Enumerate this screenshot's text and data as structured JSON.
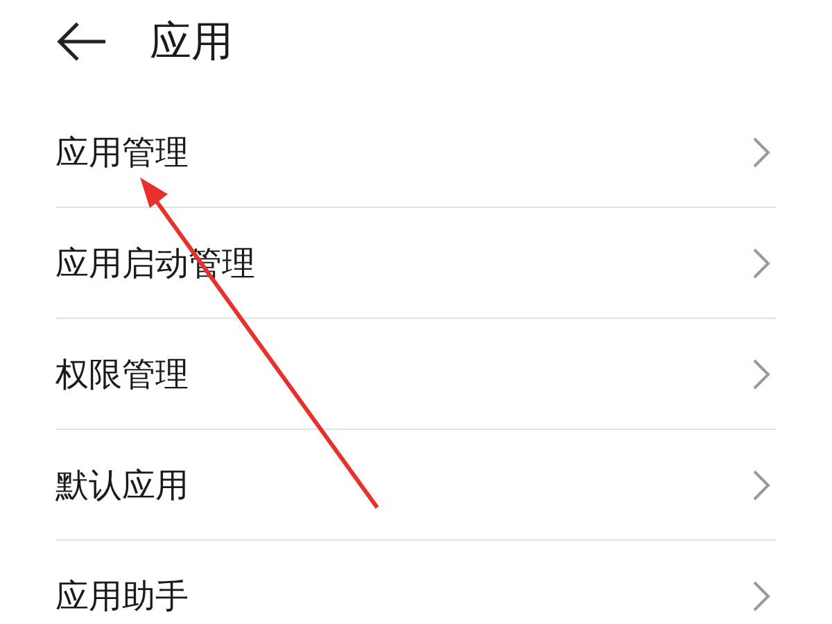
{
  "header": {
    "title": "应用"
  },
  "items": [
    {
      "label": "应用管理"
    },
    {
      "label": "应用启动管理"
    },
    {
      "label": "权限管理"
    },
    {
      "label": "默认应用"
    },
    {
      "label": "应用助手"
    }
  ]
}
